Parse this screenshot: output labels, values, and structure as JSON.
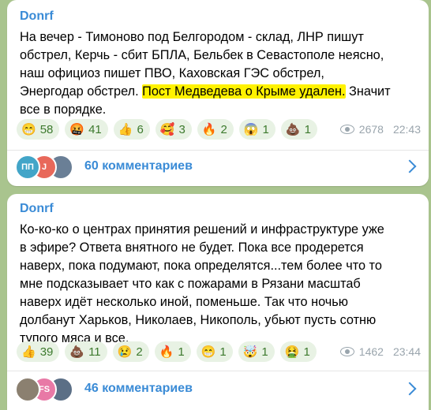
{
  "colors": {
    "background": "#a9c48e",
    "author": "#3a8bd6",
    "highlight": "#fff200",
    "pill": "#e8f2e4",
    "pill_text": "#3d7a2e"
  },
  "messages": [
    {
      "author": "Donrf",
      "text_before": "На вечер - Тимоново под Белгородом - склад, ЛНР пишут обстрел, Керчь - сбит БПЛА, Бельбек в Севастополе неясно, наш официоз пишет ПВО, Каховская ГЭС обстрел, Энергодар обстрел. ",
      "text_highlight": "Пост Медведева о Крыме удален.",
      "text_after": " Значит все в порядке.",
      "reactions": [
        {
          "icon": "😁",
          "icon_name": "grinning-face-icon",
          "count": "58"
        },
        {
          "icon": "🤬",
          "icon_name": "angry-face-icon",
          "count": "41"
        },
        {
          "icon": "👍",
          "icon_name": "thumbs-up-icon",
          "count": "6"
        },
        {
          "icon": "🥰",
          "icon_name": "smiling-hearts-face-icon",
          "count": "3"
        },
        {
          "icon": "🔥",
          "icon_name": "fire-icon",
          "count": "2"
        },
        {
          "icon": "😱",
          "icon_name": "screaming-face-icon",
          "count": "1"
        },
        {
          "icon": "💩",
          "icon_name": "poop-icon",
          "count": "1"
        }
      ],
      "views": "2678",
      "time": "22:43",
      "avatars": [
        {
          "label": "ПП",
          "color": "#42a5c8"
        },
        {
          "label": "J",
          "color": "#e8685a"
        },
        {
          "label": "",
          "color": "#6a7f96"
        }
      ],
      "comments": "60 комментариев"
    },
    {
      "author": "Donrf",
      "text_before": "Ко-ко-ко о центрах принятия решений и инфраструктуре уже в эфире? Ответа внятного не будет. Пока все продерется наверх, пока подумают, пока определятся...тем более что то мне подсказывает что как с пожарами в Рязани масштаб наверх идёт несколько иной, поменьше. Так что ночью долбанут Харьков, Николаев, Никополь, убьют пусть сотню тупого мяса и все.",
      "text_highlight": "",
      "text_after": "",
      "reactions": [
        {
          "icon": "👍",
          "icon_name": "thumbs-up-icon",
          "count": "39"
        },
        {
          "icon": "💩",
          "icon_name": "poop-icon",
          "count": "11"
        },
        {
          "icon": "😢",
          "icon_name": "crying-face-icon",
          "count": "2"
        },
        {
          "icon": "🔥",
          "icon_name": "fire-icon",
          "count": "1"
        },
        {
          "icon": "😁",
          "icon_name": "grinning-face-icon",
          "count": "1"
        },
        {
          "icon": "🤯",
          "icon_name": "exploding-head-icon",
          "count": "1"
        },
        {
          "icon": "🤮",
          "icon_name": "vomiting-face-icon",
          "count": "1"
        }
      ],
      "views": "1462",
      "time": "23:44",
      "avatars": [
        {
          "label": "",
          "color": "#8b8070"
        },
        {
          "label": "FS",
          "color": "#e879a6"
        },
        {
          "label": "",
          "color": "#5b6f86"
        }
      ],
      "comments": "46 комментариев"
    }
  ]
}
